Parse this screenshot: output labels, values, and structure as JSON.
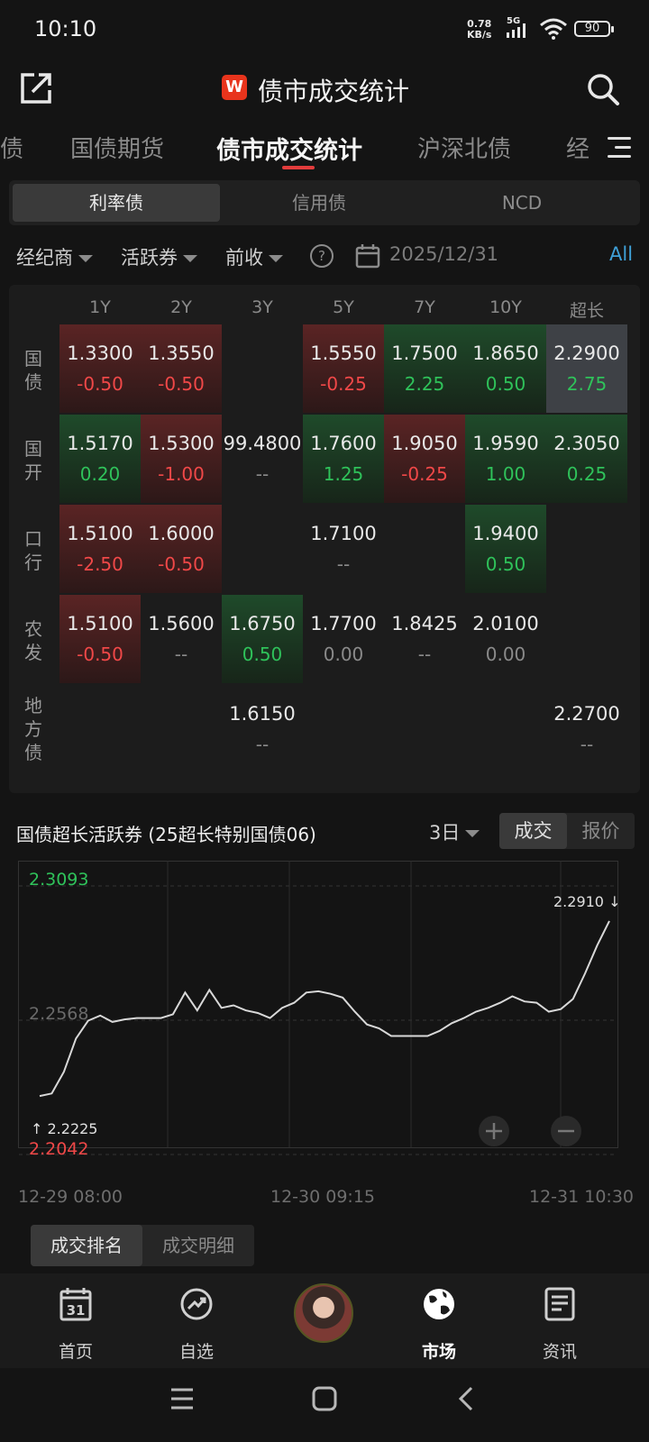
{
  "status": {
    "time": "10:10",
    "speed_value": "0.78",
    "speed_unit": "KB/s",
    "network": "5G",
    "battery": "90"
  },
  "header": {
    "title": "债市成交统计",
    "logo_letter": "W"
  },
  "tabs": [
    {
      "label": "债",
      "active": false
    },
    {
      "label": "国债期货",
      "active": false
    },
    {
      "label": "债市成交统计",
      "active": true
    },
    {
      "label": "沪深北债",
      "active": false
    },
    {
      "label": "经",
      "active": false
    }
  ],
  "segments": [
    {
      "label": "利率债",
      "active": true
    },
    {
      "label": "信用债",
      "active": false
    },
    {
      "label": "NCD",
      "active": false
    }
  ],
  "filters": {
    "broker": "经纪商",
    "active_bond": "活跃券",
    "prev_close": "前收",
    "help": "?",
    "date": "2025/12/31",
    "all": "All"
  },
  "grid": {
    "columns": [
      "1Y",
      "2Y",
      "3Y",
      "5Y",
      "7Y",
      "10Y",
      "超长"
    ],
    "rows": [
      {
        "label": "国\n债",
        "cells": [
          {
            "value": "1.3300",
            "change": "-0.50",
            "dir": "dn"
          },
          {
            "value": "1.3550",
            "change": "-0.50",
            "dir": "dn"
          },
          {
            "value": "",
            "change": "",
            "dir": "none"
          },
          {
            "value": "1.5550",
            "change": "-0.25",
            "dir": "dn"
          },
          {
            "value": "1.7500",
            "change": "2.25",
            "dir": "up"
          },
          {
            "value": "1.8650",
            "change": "0.50",
            "dir": "up"
          },
          {
            "value": "2.2900",
            "change": "2.75",
            "dir": "sel"
          }
        ]
      },
      {
        "label": "国\n开",
        "cells": [
          {
            "value": "1.5170",
            "change": "0.20",
            "dir": "up"
          },
          {
            "value": "1.5300",
            "change": "-1.00",
            "dir": "dn"
          },
          {
            "value": "99.4800",
            "change": "--",
            "dir": "nc"
          },
          {
            "value": "1.7600",
            "change": "1.25",
            "dir": "up"
          },
          {
            "value": "1.9050",
            "change": "-0.25",
            "dir": "dn"
          },
          {
            "value": "1.9590",
            "change": "1.00",
            "dir": "up"
          },
          {
            "value": "2.3050",
            "change": "0.25",
            "dir": "up"
          }
        ]
      },
      {
        "label": "口\n行",
        "cells": [
          {
            "value": "1.5100",
            "change": "-2.50",
            "dir": "dn"
          },
          {
            "value": "1.6000",
            "change": "-0.50",
            "dir": "dn"
          },
          {
            "value": "",
            "change": "",
            "dir": "none"
          },
          {
            "value": "1.7100",
            "change": "--",
            "dir": "nc"
          },
          {
            "value": "",
            "change": "",
            "dir": "none"
          },
          {
            "value": "1.9400",
            "change": "0.50",
            "dir": "up"
          },
          {
            "value": "",
            "change": "",
            "dir": "none"
          }
        ]
      },
      {
        "label": "农\n发",
        "cells": [
          {
            "value": "1.5100",
            "change": "-0.50",
            "dir": "dn"
          },
          {
            "value": "1.5600",
            "change": "--",
            "dir": "nc"
          },
          {
            "value": "1.6750",
            "change": "0.50",
            "dir": "up"
          },
          {
            "value": "1.7700",
            "change": "0.00",
            "dir": "nc"
          },
          {
            "value": "1.8425",
            "change": "--",
            "dir": "nc"
          },
          {
            "value": "2.0100",
            "change": "0.00",
            "dir": "nc"
          },
          {
            "value": "",
            "change": "",
            "dir": "none"
          }
        ]
      },
      {
        "label": "地\n方\n债",
        "cells": [
          {
            "value": "",
            "change": "",
            "dir": "none"
          },
          {
            "value": "",
            "change": "",
            "dir": "none"
          },
          {
            "value": "1.6150",
            "change": "--",
            "dir": "nc"
          },
          {
            "value": "",
            "change": "",
            "dir": "none"
          },
          {
            "value": "",
            "change": "",
            "dir": "none"
          },
          {
            "value": "",
            "change": "",
            "dir": "none"
          },
          {
            "value": "2.2700",
            "change": "--",
            "dir": "nc"
          }
        ]
      }
    ]
  },
  "chart_section": {
    "title": "国债超长活跃券 (25超长特别国债06)",
    "range": "3日",
    "toggle": [
      {
        "label": "成交",
        "active": true
      },
      {
        "label": "报价",
        "active": false
      }
    ],
    "x_labels": [
      "12-29 08:00",
      "12-30 09:15",
      "12-31 10:30"
    ]
  },
  "chart_data": {
    "type": "line",
    "title": "",
    "xlabel": "",
    "ylabel": "",
    "ylim": [
      2.2042,
      2.3093
    ],
    "y_ticks": [
      "2.3093",
      "2.2568",
      "2.2042"
    ],
    "high_label": "2.2910",
    "low_label": "2.2225",
    "x_ticks": [
      "12-29 08:00",
      "12-30 09:15",
      "12-31 10:30"
    ],
    "series": [
      {
        "values": [
          2.2225,
          2.2235,
          2.232,
          2.245,
          2.252,
          2.254,
          2.2515,
          2.2525,
          2.253,
          2.253,
          2.253,
          2.2545,
          2.263,
          2.256,
          2.264,
          2.257,
          2.258,
          2.256,
          2.255,
          2.253,
          2.257,
          2.259,
          2.263,
          2.2635,
          2.2625,
          2.261,
          2.2555,
          2.2505,
          2.249,
          2.246,
          2.246,
          2.246,
          2.246,
          2.248,
          2.251,
          2.253,
          2.2555,
          2.257,
          2.259,
          2.2615,
          2.2595,
          2.259,
          2.2555,
          2.2565,
          2.2605,
          2.2705,
          2.2815,
          2.291
        ]
      }
    ]
  },
  "subtabs": [
    {
      "label": "成交排名",
      "active": true
    },
    {
      "label": "成交明细",
      "active": false
    }
  ],
  "bottom_nav": [
    {
      "label": "首页",
      "icon": "calendar-31-icon",
      "active": false
    },
    {
      "label": "自选",
      "icon": "trend-circle-icon",
      "active": false
    },
    {
      "label": "",
      "icon": "avatar",
      "active": false
    },
    {
      "label": "市场",
      "icon": "globe-icon",
      "active": true
    },
    {
      "label": "资讯",
      "icon": "news-icon",
      "active": false
    }
  ],
  "calendar_day": "31",
  "colors": {
    "up": "#2fc25a",
    "down": "#f04848",
    "accent": "#e23c3c",
    "link": "#3fa0d8"
  }
}
